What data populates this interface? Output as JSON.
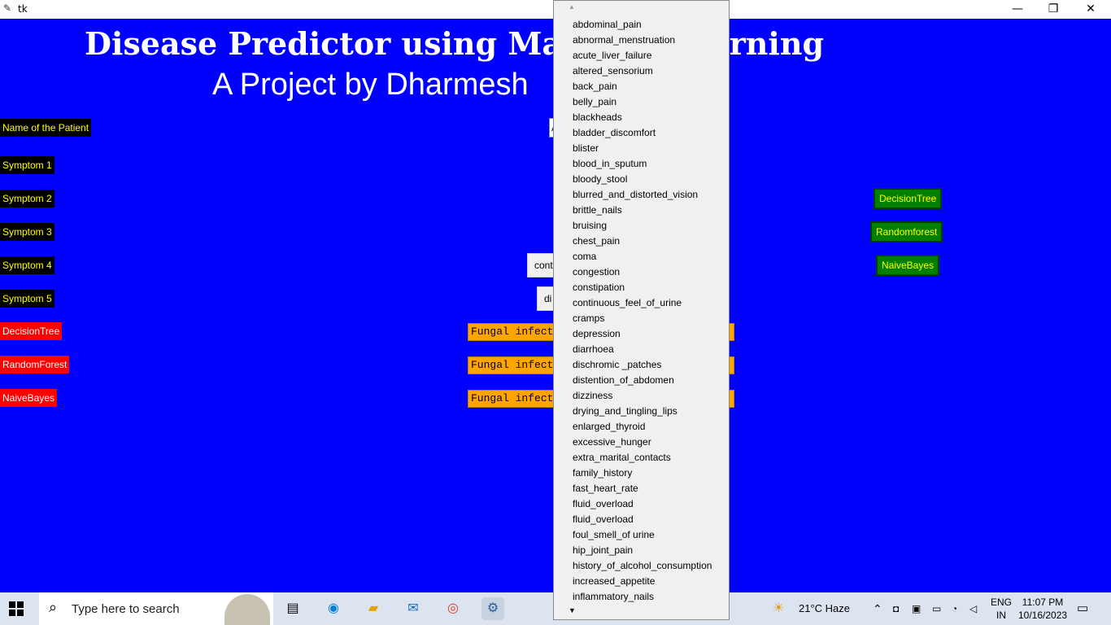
{
  "window": {
    "title": "tk",
    "minimize": "—",
    "restore": "❐",
    "close": "✕"
  },
  "header": {
    "title": "Disease Predictor using Machine Learning",
    "subtitle": "A Project by  Dharmesh"
  },
  "form": {
    "name_label": "Name of the Patient",
    "name_value": "A",
    "symptom_labels": [
      "Symptom 1",
      "Symptom 2",
      "Symptom 3",
      "Symptom 4",
      "Symptom 5"
    ],
    "symptom4_value": "cont",
    "symptom5_value": "di"
  },
  "results": {
    "labels": [
      "DecisionTree",
      "RandomForest",
      "NaiveBayes"
    ],
    "values": [
      "Fungal infect",
      "Fungal infect",
      "Fungal infect"
    ]
  },
  "buttons": {
    "decision_tree": "DecisionTree",
    "random_forest": "Randomforest",
    "naive_bayes": "NaiveBayes"
  },
  "dropdown": {
    "scroll_up": "▲",
    "scroll_down": "▼",
    "items": [
      "abdominal_pain",
      "abnormal_menstruation",
      "acute_liver_failure",
      "altered_sensorium",
      "back_pain",
      "belly_pain",
      "blackheads",
      "bladder_discomfort",
      "blister",
      "blood_in_sputum",
      "bloody_stool",
      "blurred_and_distorted_vision",
      "brittle_nails",
      "bruising",
      "chest_pain",
      "coma",
      "congestion",
      "constipation",
      "continuous_feel_of_urine",
      "cramps",
      "depression",
      "diarrhoea",
      "dischromic _patches",
      "distention_of_abdomen",
      "dizziness",
      "drying_and_tingling_lips",
      "enlarged_thyroid",
      "excessive_hunger",
      "extra_marital_contacts",
      "family_history",
      "fast_heart_rate",
      "fluid_overload",
      "fluid_overload",
      "foul_smell_of urine",
      "hip_joint_pain",
      "history_of_alcohol_consumption",
      "increased_appetite",
      "inflammatory_nails"
    ]
  },
  "taskbar": {
    "search_placeholder": "Type here to search",
    "weather": "21°C  Haze",
    "lang1": "ENG",
    "lang2": "IN",
    "time": "11:07 PM",
    "date": "10/16/2023",
    "icons": [
      "windows-start-icon",
      "search-icon",
      "task-view-icon",
      "edge-icon",
      "file-explorer-icon",
      "mail-icon",
      "chrome-icon",
      "python-icon",
      "notification-icon"
    ]
  }
}
